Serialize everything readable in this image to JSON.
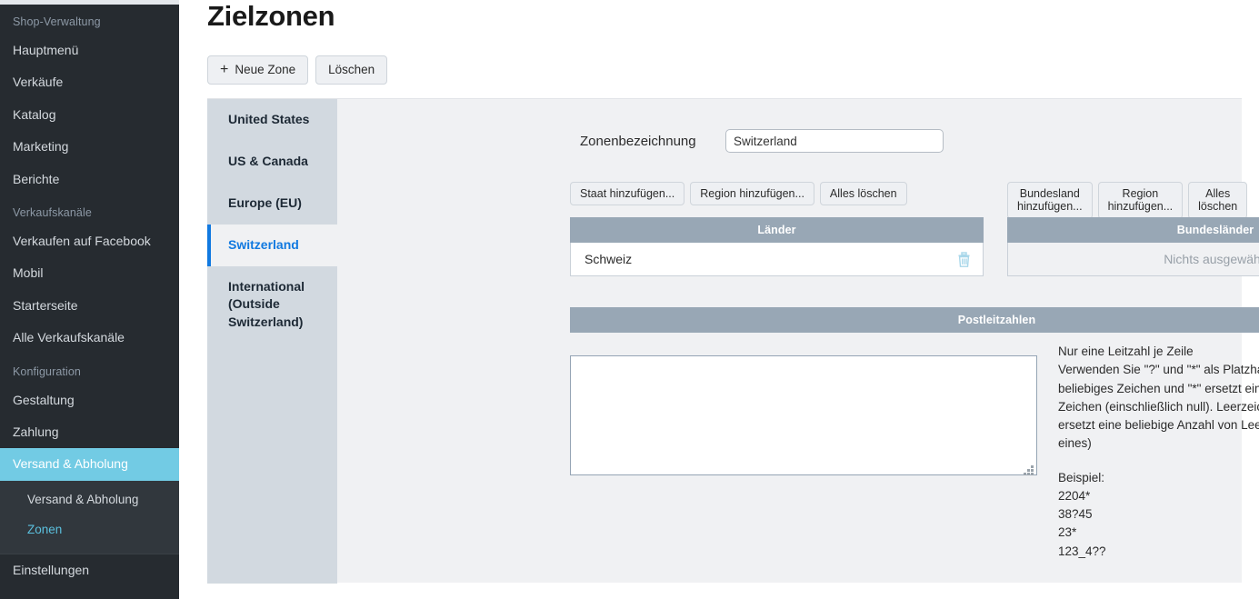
{
  "sidebar": {
    "sections": [
      {
        "label": "Shop-Verwaltung",
        "items": [
          {
            "label": "Hauptmenü"
          },
          {
            "label": "Verkäufe"
          },
          {
            "label": "Katalog"
          },
          {
            "label": "Marketing"
          },
          {
            "label": "Berichte"
          }
        ]
      },
      {
        "label": "Verkaufskanäle",
        "items": [
          {
            "label": "Verkaufen auf Facebook"
          },
          {
            "label": "Mobil"
          },
          {
            "label": "Starterseite"
          },
          {
            "label": "Alle Verkaufskanäle"
          }
        ]
      },
      {
        "label": "Konfiguration",
        "items": [
          {
            "label": "Gestaltung"
          },
          {
            "label": "Zahlung"
          },
          {
            "label": "Versand & Abholung"
          }
        ]
      }
    ],
    "subitems": [
      {
        "label": "Versand & Abholung"
      },
      {
        "label": "Zonen"
      }
    ],
    "bottom": {
      "label": "Einstellungen"
    },
    "active_item": "Versand & Abholung",
    "active_subitem": "Zonen",
    "accent_color": "#72cbe4",
    "sublink_color": "#5bc0de"
  },
  "header": {
    "title": "Zielzonen",
    "new_zone_label": "Neue Zone",
    "new_zone_icon": "plus-icon",
    "delete_label": "Löschen"
  },
  "zone_list": {
    "items": [
      {
        "label": "United States"
      },
      {
        "label": "US & Canada"
      },
      {
        "label": "Europe (EU)"
      },
      {
        "label": "Switzerland"
      },
      {
        "label": "International (Outside Switzerland)"
      }
    ],
    "active": "Switzerland",
    "active_color": "#1179e0"
  },
  "form": {
    "name_label": "Zonenbezeichnung",
    "name_value": "Switzerland",
    "name_placeholder": "",
    "countries_buttons": [
      {
        "label": "Staat hinzufügen..."
      },
      {
        "label": "Region hinzufügen..."
      },
      {
        "label": "Alles löschen"
      }
    ],
    "states_buttons": [
      {
        "label": "Bundesland hinzufügen..."
      },
      {
        "label": "Region hinzufügen..."
      },
      {
        "label": "Alles löschen"
      }
    ],
    "countries_table": {
      "header": "Länder",
      "rows": [
        {
          "label": "Schweiz",
          "delete_icon": "trash-icon"
        }
      ]
    },
    "states_table": {
      "header": "Bundesländer",
      "empty_text": "Nichts ausgewählt"
    },
    "zip_table": {
      "header": "Postleitzahlen",
      "value": "",
      "placeholder": ""
    },
    "hint": {
      "line1": "Nur eine Leitzahl je Zeile",
      "line2": "Verwenden Sie \"?\" und \"*\" als Platzhalter. \"?\" ersetzt ein beliebiges Zeichen und \"*\" ersetzt eine beliebige Anzahl von Zeichen (einschließlich null). Leerzeichen werden ignoriert. \"_\" ersetzt eine beliebige Anzahl von Leerzeichen (mindestens eines)",
      "examples_title": "Beispiel:",
      "examples": [
        "2204*",
        "38?45",
        "23*",
        "123_4??"
      ]
    }
  }
}
